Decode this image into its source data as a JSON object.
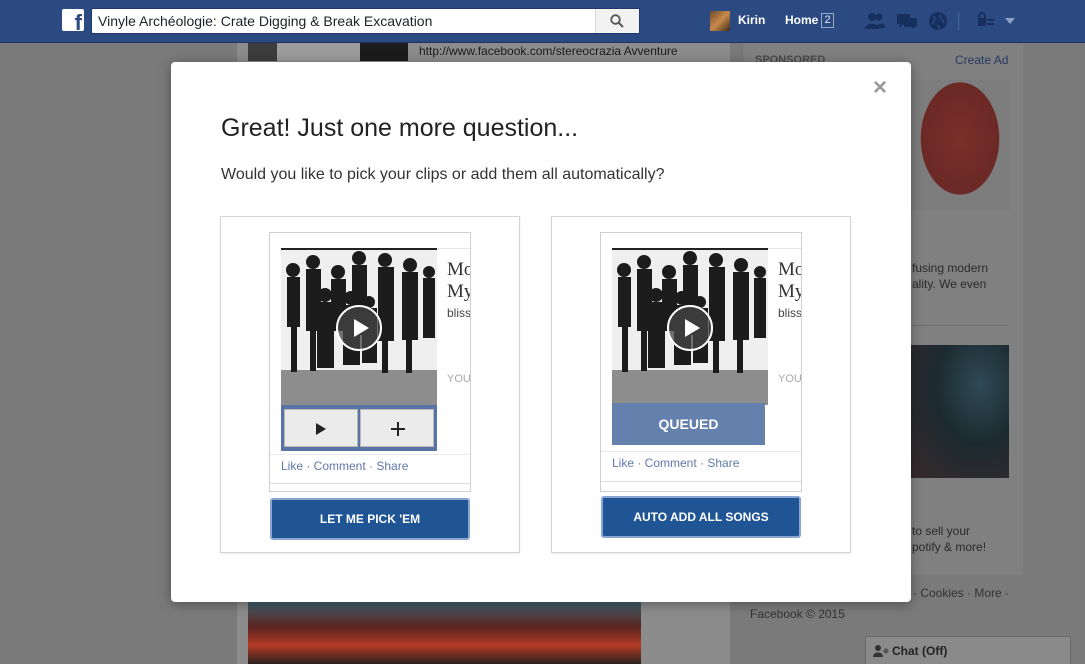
{
  "topbar": {
    "search_value": "Vinyle Archéologie: Crate Digging & Break Excavation",
    "user_name": "Kirin",
    "home_label": "Home",
    "home_count": "2"
  },
  "background": {
    "post_link": "http://www.facebook.com/stereocrazia Avventure",
    "sponsored_label": "SPONSORED",
    "create_ad_label": "Create Ad",
    "ad1_text_line1": "fusing modern",
    "ad1_text_line2": "ality. We even",
    "ad2_text_line1": "to sell your",
    "ad2_text_line2": "potify & more!",
    "footer_links": "· Cookies · More ·",
    "footer_copyright": "Facebook © 2015",
    "chat_label": "Chat (Off)"
  },
  "modal": {
    "close_label": "×",
    "title": "Great! Just one more question...",
    "subtitle": "Would you like to pick your clips or add them all automatically?",
    "options": [
      {
        "card_title_line1": "Mo",
        "card_title_line2": "My",
        "card_artist": "bliss",
        "card_you": "YOU",
        "actions": "Like · Comment · Share",
        "button_label": "LET ME PICK 'EM"
      },
      {
        "card_title_line1": "Mo",
        "card_title_line2": "My",
        "card_artist": "bliss",
        "card_you": "YOU",
        "queued_label": "QUEUED",
        "actions": "Like · Comment · Share",
        "button_label": "AUTO ADD ALL SONGS"
      }
    ]
  },
  "colors": {
    "topbar": "#2c4a82",
    "cta": "#1f5495",
    "queued": "#6480ad",
    "link": "#5f78ab"
  }
}
